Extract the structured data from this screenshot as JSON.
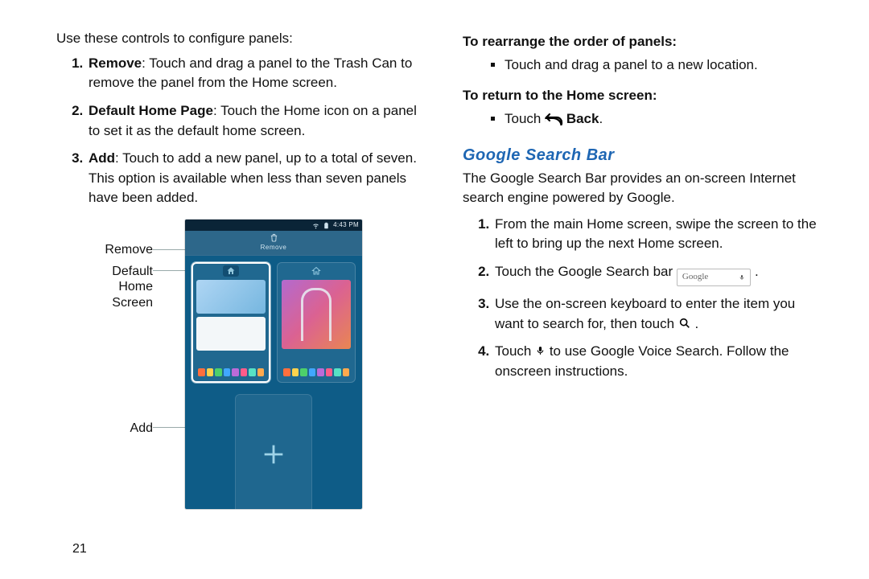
{
  "page_number": "21",
  "left": {
    "intro": "Use these controls to configure panels:",
    "steps": [
      {
        "term": "Remove",
        "text": ": Touch and drag a panel to the Trash Can to remove the panel from the Home screen."
      },
      {
        "term": "Default Home Page",
        "text": ": Touch the Home icon on a panel to set it as the default home screen."
      },
      {
        "term": "Add",
        "text": ": Touch to add a new panel, up to a total of seven. This option is available when less than seven panels have been added."
      }
    ],
    "callouts": {
      "remove": "Remove",
      "default": "Default\nHome\nScreen",
      "add": "Add"
    },
    "phone": {
      "time": "4:43 PM",
      "remove_label": "Remove"
    }
  },
  "right": {
    "h_rearrange": "To rearrange the order of panels:",
    "rearrange_item": "Touch and drag a panel to a new location.",
    "h_return": "To return to the Home screen:",
    "return_pre": "Touch ",
    "return_post": " Back",
    "return_period": ".",
    "section": "Google Search Bar",
    "section_desc": "The Google Search Bar provides an on-screen Internet search engine powered by Google.",
    "steps": {
      "s1": "From the main Home screen, swipe the screen to the left to bring up the next Home screen.",
      "s2_pre": "Touch the Google Search bar ",
      "s2_post": ".",
      "s3_pre": "Use the on-screen keyboard to enter the item you want to search for, then touch ",
      "s3_post": ".",
      "s4_pre": "Touch ",
      "s4_post": " to use Google Voice Search. Follow the onscreen instructions."
    },
    "g_label": "Google"
  }
}
